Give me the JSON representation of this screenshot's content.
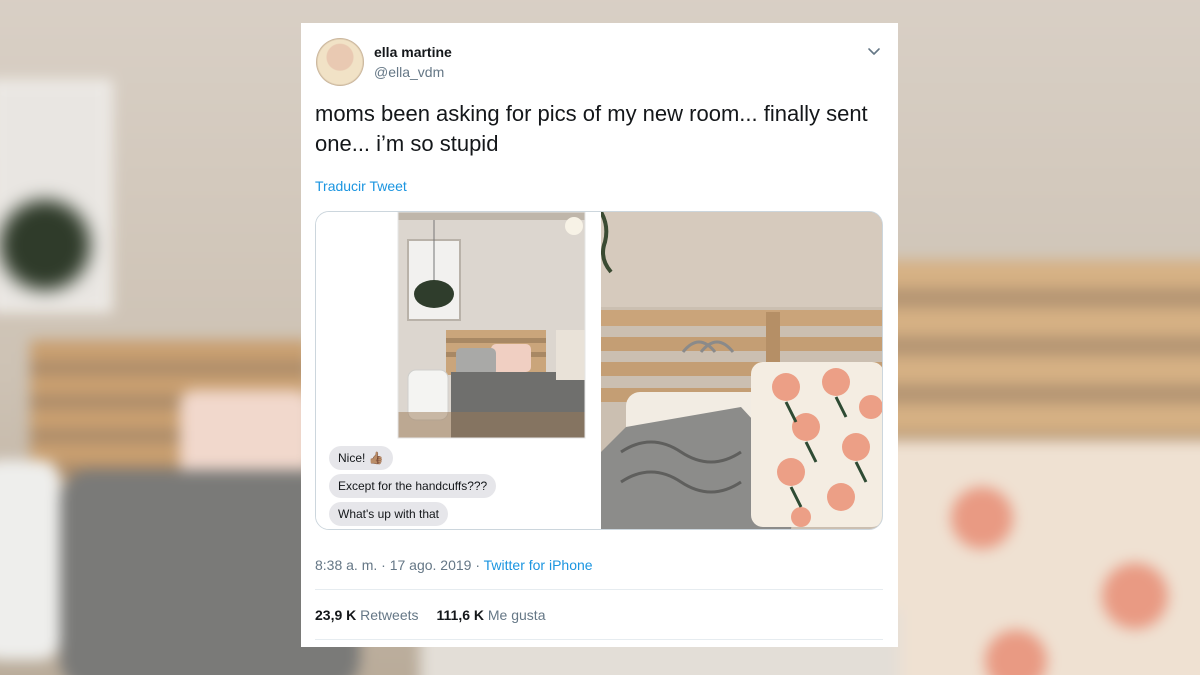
{
  "tweet": {
    "author_name": "ella martine",
    "author_handle": "@ella_vdm",
    "text": "moms been asking for pics of my new room... finally sent one... i’m so stupid",
    "translate_label": "Traducir Tweet",
    "timestamp": "8:38 a. m. · 17 ago. 2019 · ",
    "source": "Twitter for iPhone",
    "retweets_count": "23,9 K",
    "retweets_label": "Retweets",
    "likes_count": "111,6 K",
    "likes_label": "Me gusta"
  },
  "media": {
    "messages": [
      "Nice! 👍🏽",
      "Except for the handcuffs???",
      "What's up with that"
    ]
  },
  "icons": {
    "menu": "chevron-down-icon"
  },
  "colors": {
    "link": "#1b95e0",
    "text": "#14171a",
    "muted": "#657786"
  }
}
